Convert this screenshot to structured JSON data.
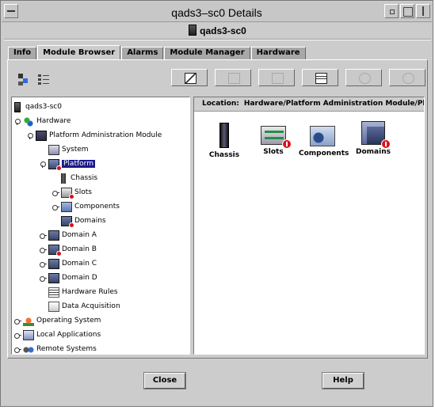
{
  "window": {
    "title": "qads3–sc0 Details",
    "subtitle": "qads3-sc0"
  },
  "tabs": [
    {
      "label": "Info",
      "active": false
    },
    {
      "label": "Module Browser",
      "active": true
    },
    {
      "label": "Alarms",
      "active": false
    },
    {
      "label": "Module Manager",
      "active": false
    },
    {
      "label": "Hardware",
      "active": false
    }
  ],
  "toolbar": {
    "left_icons": [
      "tree-view-icon",
      "list-view-icon"
    ],
    "buttons": [
      {
        "icon": "edit-icon",
        "enabled": true
      },
      {
        "icon": "properties-icon",
        "enabled": false
      },
      {
        "icon": "graph-icon",
        "enabled": false
      },
      {
        "icon": "grid-icon",
        "enabled": true
      },
      {
        "icon": "refresh-icon",
        "enabled": false
      },
      {
        "icon": "sync-icon",
        "enabled": false
      }
    ]
  },
  "tree": [
    {
      "label": "qads3-sc0",
      "icon": "host-icon"
    },
    {
      "label": "Hardware",
      "icon": "hardware-icon"
    },
    {
      "label": "Platform Administration Module",
      "icon": "module-icon"
    },
    {
      "label": "System",
      "icon": "system-icon"
    },
    {
      "label": "Platform",
      "icon": "platform-icon",
      "selected": true
    },
    {
      "label": "Chassis",
      "icon": "chassis-icon"
    },
    {
      "label": "Slots",
      "icon": "slots-icon"
    },
    {
      "label": "Components",
      "icon": "components-icon"
    },
    {
      "label": "Domains",
      "icon": "domains-icon"
    },
    {
      "label": "Domain A",
      "icon": "domain-icon"
    },
    {
      "label": "Domain B",
      "icon": "domain-icon"
    },
    {
      "label": "Domain C",
      "icon": "domain-icon"
    },
    {
      "label": "Domain D",
      "icon": "domain-icon"
    },
    {
      "label": "Hardware Rules",
      "icon": "rules-icon"
    },
    {
      "label": "Data Acquisition",
      "icon": "data-icon"
    },
    {
      "label": "Operating System",
      "icon": "os-icon"
    },
    {
      "label": "Local Applications",
      "icon": "local-apps-icon"
    },
    {
      "label": "Remote Systems",
      "icon": "remote-systems-icon"
    }
  ],
  "location": {
    "label": "Location:",
    "value": "Hardware/Platform Administration Module/Platform"
  },
  "content_items": [
    {
      "label": "Chassis",
      "icon": "chassis-icon",
      "alarm": false
    },
    {
      "label": "Slots",
      "icon": "slots-icon",
      "alarm": true
    },
    {
      "label": "Components",
      "icon": "components-icon",
      "alarm": false
    },
    {
      "label": "Domains",
      "icon": "domains-icon",
      "alarm": true
    }
  ],
  "buttons": {
    "close": "Close",
    "help": "Help"
  },
  "colors": {
    "background": "#cccccc",
    "selection": "#1a1a8a",
    "alarm": "#d8101a"
  }
}
